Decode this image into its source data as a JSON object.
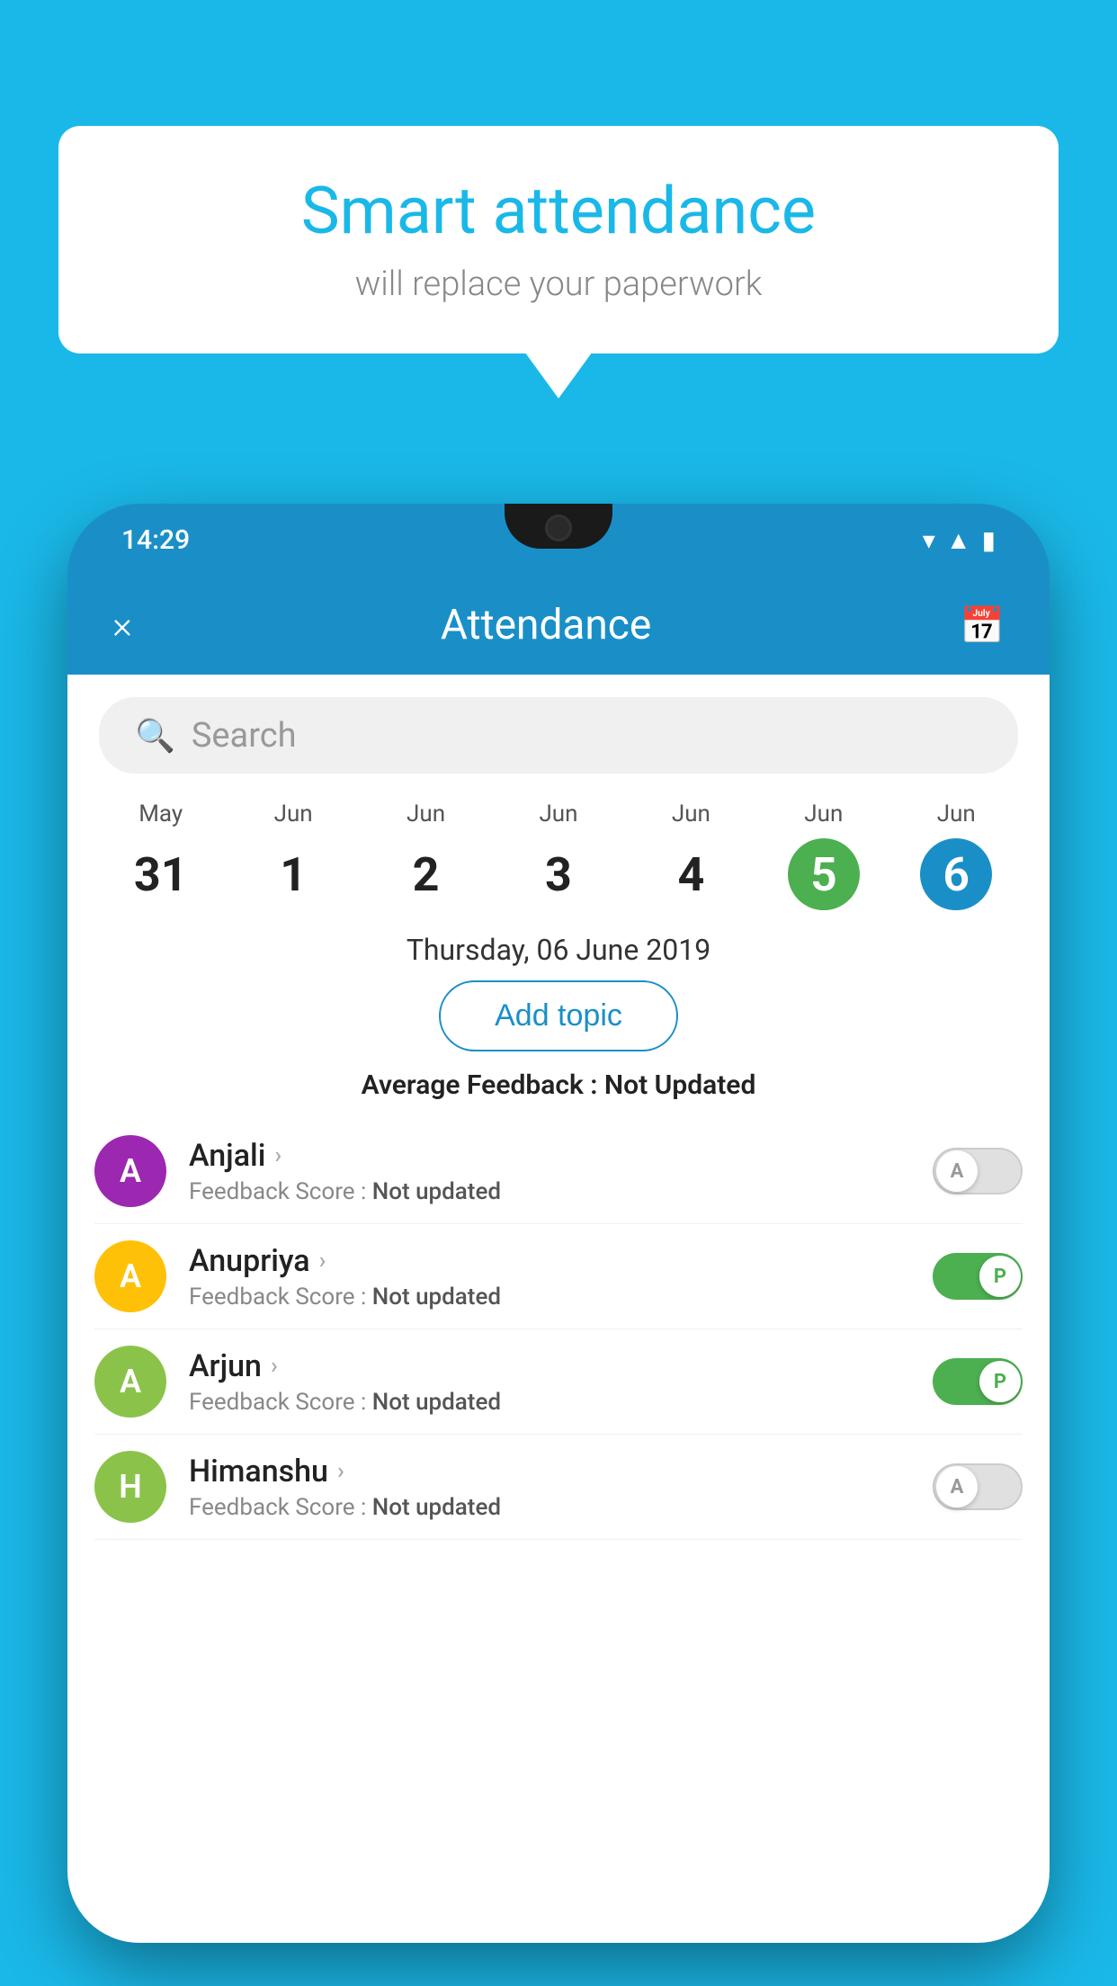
{
  "background_color": "#1ab8e8",
  "speech_bubble": {
    "headline": "Smart attendance",
    "subtext": "will replace your paperwork"
  },
  "phone": {
    "status_bar": {
      "time": "14:29",
      "icons": [
        "wifi",
        "signal",
        "battery"
      ]
    },
    "header": {
      "close_label": "×",
      "title": "Attendance",
      "calendar_icon": "📅"
    },
    "search": {
      "placeholder": "Search"
    },
    "date_scroller": [
      {
        "month": "May",
        "day": "31",
        "style": "normal"
      },
      {
        "month": "Jun",
        "day": "1",
        "style": "normal"
      },
      {
        "month": "Jun",
        "day": "2",
        "style": "normal"
      },
      {
        "month": "Jun",
        "day": "3",
        "style": "normal"
      },
      {
        "month": "Jun",
        "day": "4",
        "style": "normal"
      },
      {
        "month": "Jun",
        "day": "5",
        "style": "green"
      },
      {
        "month": "Jun",
        "day": "6",
        "style": "blue"
      }
    ],
    "selected_date": "Thursday, 06 June 2019",
    "add_topic_label": "Add topic",
    "avg_feedback_label": "Average Feedback :",
    "avg_feedback_value": "Not Updated",
    "students": [
      {
        "name": "Anjali",
        "avatar_letter": "A",
        "avatar_color": "#9c27b0",
        "feedback_label": "Feedback Score :",
        "feedback_value": "Not updated",
        "toggle_state": "off",
        "toggle_label": "A"
      },
      {
        "name": "Anupriya",
        "avatar_letter": "A",
        "avatar_color": "#ffc107",
        "feedback_label": "Feedback Score :",
        "feedback_value": "Not updated",
        "toggle_state": "on",
        "toggle_label": "P"
      },
      {
        "name": "Arjun",
        "avatar_letter": "A",
        "avatar_color": "#8bc34a",
        "feedback_label": "Feedback Score :",
        "feedback_value": "Not updated",
        "toggle_state": "on",
        "toggle_label": "P"
      },
      {
        "name": "Himanshu",
        "avatar_letter": "H",
        "avatar_color": "#8bc34a",
        "feedback_label": "Feedback Score :",
        "feedback_value": "Not updated",
        "toggle_state": "off",
        "toggle_label": "A"
      }
    ]
  }
}
